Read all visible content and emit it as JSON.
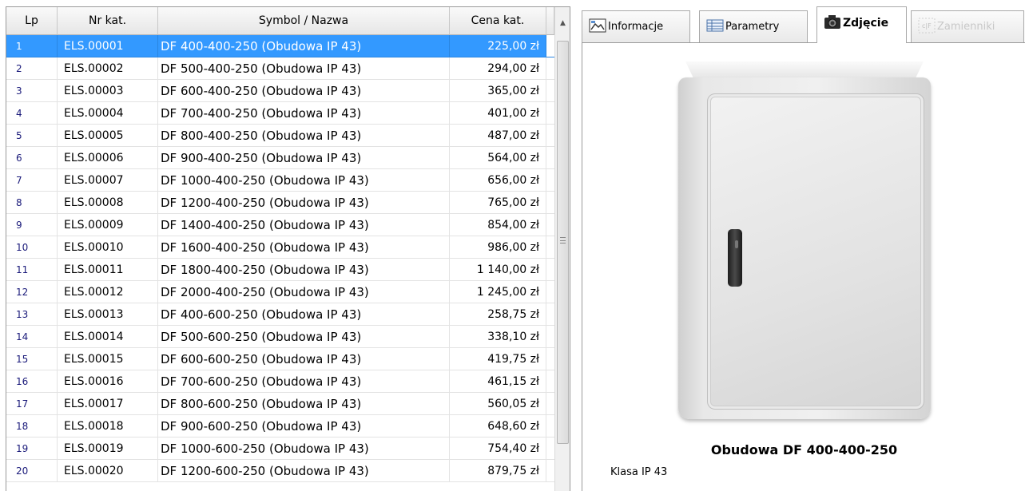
{
  "grid": {
    "columns": [
      "Lp",
      "Nr kat.",
      "Symbol / Nazwa",
      "Cena kat."
    ],
    "selected_index": 0,
    "rows": [
      {
        "lp": "1",
        "nr": "ELS.00001",
        "name": "DF 400-400-250 (Obudowa IP 43)",
        "price": "225,00 zł"
      },
      {
        "lp": "2",
        "nr": "ELS.00002",
        "name": "DF 500-400-250 (Obudowa IP 43)",
        "price": "294,00 zł"
      },
      {
        "lp": "3",
        "nr": "ELS.00003",
        "name": "DF 600-400-250 (Obudowa IP 43)",
        "price": "365,00 zł"
      },
      {
        "lp": "4",
        "nr": "ELS.00004",
        "name": "DF 700-400-250 (Obudowa IP 43)",
        "price": "401,00 zł"
      },
      {
        "lp": "5",
        "nr": "ELS.00005",
        "name": "DF 800-400-250 (Obudowa IP 43)",
        "price": "487,00 zł"
      },
      {
        "lp": "6",
        "nr": "ELS.00006",
        "name": "DF 900-400-250 (Obudowa IP 43)",
        "price": "564,00 zł"
      },
      {
        "lp": "7",
        "nr": "ELS.00007",
        "name": "DF 1000-400-250 (Obudowa IP 43)",
        "price": "656,00 zł"
      },
      {
        "lp": "8",
        "nr": "ELS.00008",
        "name": "DF 1200-400-250 (Obudowa IP 43)",
        "price": "765,00 zł"
      },
      {
        "lp": "9",
        "nr": "ELS.00009",
        "name": "DF 1400-400-250 (Obudowa IP 43)",
        "price": "854,00 zł"
      },
      {
        "lp": "10",
        "nr": "ELS.00010",
        "name": "DF 1600-400-250 (Obudowa IP 43)",
        "price": "986,00 zł"
      },
      {
        "lp": "11",
        "nr": "ELS.00011",
        "name": "DF 1800-400-250 (Obudowa IP 43)",
        "price": "1 140,00 zł"
      },
      {
        "lp": "12",
        "nr": "ELS.00012",
        "name": "DF 2000-400-250 (Obudowa IP 43)",
        "price": "1 245,00 zł"
      },
      {
        "lp": "13",
        "nr": "ELS.00013",
        "name": "DF 400-600-250 (Obudowa IP 43)",
        "price": "258,75 zł"
      },
      {
        "lp": "14",
        "nr": "ELS.00014",
        "name": "DF 500-600-250 (Obudowa IP 43)",
        "price": "338,10 zł"
      },
      {
        "lp": "15",
        "nr": "ELS.00015",
        "name": "DF 600-600-250 (Obudowa IP 43)",
        "price": "419,75 zł"
      },
      {
        "lp": "16",
        "nr": "ELS.00016",
        "name": "DF 700-600-250 (Obudowa IP 43)",
        "price": "461,15 zł"
      },
      {
        "lp": "17",
        "nr": "ELS.00017",
        "name": "DF 800-600-250 (Obudowa IP 43)",
        "price": "560,05 zł"
      },
      {
        "lp": "18",
        "nr": "ELS.00018",
        "name": "DF 900-600-250 (Obudowa IP 43)",
        "price": "648,60 zł"
      },
      {
        "lp": "19",
        "nr": "ELS.00019",
        "name": "DF 1000-600-250 (Obudowa IP 43)",
        "price": "754,40 zł"
      },
      {
        "lp": "20",
        "nr": "ELS.00020",
        "name": "DF 1200-600-250 (Obudowa IP 43)",
        "price": "879,75 zł"
      }
    ]
  },
  "tabs": [
    {
      "label": "Informacje",
      "icon": "image-icon"
    },
    {
      "label": "Parametry",
      "icon": "table-icon"
    },
    {
      "label": "Zdjęcie",
      "icon": "camera-icon",
      "active": true
    },
    {
      "label": "Zamienniki",
      "icon": "replacement-icon",
      "disabled": true
    }
  ],
  "product": {
    "name": "Obudowa DF 400-400-250",
    "class": "Klasa IP 43"
  },
  "colors": {
    "selection": "#3399ff",
    "lp_text": "#1a1a7a",
    "disabled_tab_text": "#c8c8c8"
  }
}
